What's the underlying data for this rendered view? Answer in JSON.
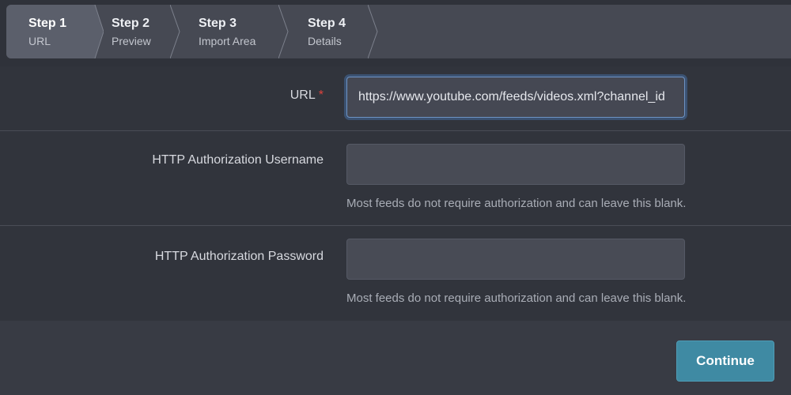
{
  "wizard": {
    "steps": [
      {
        "title": "Step 1",
        "subtitle": "URL",
        "active": true
      },
      {
        "title": "Step 2",
        "subtitle": "Preview",
        "active": false
      },
      {
        "title": "Step 3",
        "subtitle": "Import Area",
        "active": false
      },
      {
        "title": "Step 4",
        "subtitle": "Details",
        "active": false
      }
    ]
  },
  "form": {
    "url": {
      "label": "URL",
      "required_marker": "*",
      "value": "https://www.youtube.com/feeds/videos.xml?channel_id"
    },
    "username": {
      "label": "HTTP Authorization Username",
      "value": "",
      "help": "Most feeds do not require authorization and can leave this blank."
    },
    "password": {
      "label": "HTTP Authorization Password",
      "value": "",
      "help": "Most feeds do not require authorization and can leave this blank."
    }
  },
  "footer": {
    "continue_label": "Continue"
  },
  "colors": {
    "accent": "#3f8aa3",
    "required": "#e0433d",
    "focus": "#6e93c4"
  }
}
